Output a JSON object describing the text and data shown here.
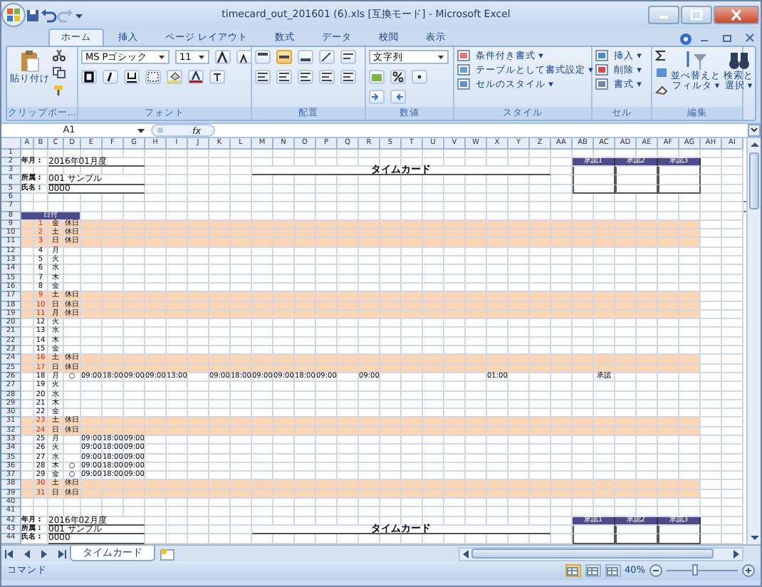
{
  "window": {
    "title": "timecard_out_201601 (6).xls  [互換モード] - Microsoft Excel"
  },
  "tabs": [
    {
      "label": "ホーム",
      "selected": true
    },
    {
      "label": "挿入",
      "selected": false
    },
    {
      "label": "ページ レイアウト",
      "selected": false
    },
    {
      "label": "数式",
      "selected": false
    },
    {
      "label": "データ",
      "selected": false
    },
    {
      "label": "校閲",
      "selected": false
    },
    {
      "label": "表示",
      "selected": false
    }
  ],
  "ribbon": {
    "groups": [
      {
        "kind": "clipboard",
        "label": "クリップボー…",
        "texts": [
          "貼り付け"
        ]
      },
      {
        "kind": "font",
        "label": "フォント",
        "texts": [
          "MS Pゴシック",
          "11"
        ]
      },
      {
        "kind": "alignment",
        "label": "配置"
      },
      {
        "kind": "number",
        "label": "数値",
        "texts": [
          "文字列"
        ]
      },
      {
        "kind": "styles",
        "label": "スタイル",
        "texts": [
          "条件付き書式 ▾",
          "テーブルとして書式設定 ▾",
          "セルのスタイル ▾"
        ]
      },
      {
        "kind": "cells",
        "label": "セル",
        "texts": [
          "挿入 ▾",
          "削除 ▾",
          "書式 ▾"
        ]
      },
      {
        "kind": "editing",
        "label": "編集",
        "texts": [
          "並べ替えと",
          "フィルタ ▾",
          "検索と",
          "選択 ▾"
        ]
      }
    ]
  },
  "formula_bar": {
    "name_box": "A1",
    "fx": "fx"
  },
  "sheet": {
    "columns": [
      "A",
      "B",
      "C",
      "D",
      "E",
      "F",
      "G",
      "H",
      "I",
      "J",
      "K",
      "L",
      "M",
      "N",
      "O",
      "P",
      "Q",
      "R",
      "S",
      "T",
      "U",
      "V",
      "W",
      "X",
      "Y",
      "Z",
      "AA",
      "AB",
      "AC",
      "AD",
      "AE",
      "AF",
      "AG",
      "AH",
      "AI"
    ],
    "row_numbers": [
      "1",
      "2",
      "3",
      "4",
      "5",
      "6",
      "7",
      "8",
      "9",
      "10",
      "11",
      "12",
      "13",
      "14",
      "15",
      "16",
      "17",
      "18",
      "19",
      "20",
      "21",
      "22",
      "23",
      "24",
      "25",
      "26",
      "27",
      "28",
      "29",
      "30",
      "31",
      "32",
      "33",
      "34",
      "35",
      "36",
      "37",
      "38",
      "39",
      "40",
      "41",
      "42",
      "43",
      "44"
    ],
    "cards": [
      {
        "title": "タイムカード",
        "fields": [
          {
            "label": "年月 :",
            "value": "2016年01月度"
          },
          {
            "label": "所属 :",
            "value": "001 サンプル"
          },
          {
            "label": "氏名 :",
            "value": "0000"
          }
        ],
        "approvals": [
          "承認1",
          "承認2",
          "承認3"
        ]
      },
      {
        "title": "タイムカード",
        "fields": [
          {
            "label": "年月 :",
            "value": "2016年02月度"
          },
          {
            "label": "所属 :",
            "value": "001 サンプル"
          },
          {
            "label": "氏名 :",
            "value": "0000"
          }
        ],
        "approvals": [
          "承認1",
          "承認2",
          "承認3"
        ]
      }
    ],
    "band_label": "日付",
    "days": [
      {
        "kind": "holiday",
        "day": "1",
        "weekday": "金",
        "status": "休日"
      },
      {
        "kind": "holiday",
        "day": "2",
        "weekday": "土",
        "status": "休日"
      },
      {
        "kind": "holiday",
        "day": "3",
        "weekday": "日",
        "status": "休日"
      },
      {
        "kind": "workday",
        "day": "4",
        "weekday": "月"
      },
      {
        "kind": "workday",
        "day": "5",
        "weekday": "火"
      },
      {
        "kind": "workday",
        "day": "6",
        "weekday": "水"
      },
      {
        "kind": "workday",
        "day": "7",
        "weekday": "木"
      },
      {
        "kind": "workday",
        "day": "8",
        "weekday": "金"
      },
      {
        "kind": "holiday",
        "day": "9",
        "weekday": "土",
        "status": "休日"
      },
      {
        "kind": "holiday",
        "day": "10",
        "weekday": "日",
        "status": "休日"
      },
      {
        "kind": "holiday",
        "day": "11",
        "weekday": "月",
        "status": "休日"
      },
      {
        "kind": "workday",
        "day": "12",
        "weekday": "火"
      },
      {
        "kind": "workday",
        "day": "13",
        "weekday": "水"
      },
      {
        "kind": "workday",
        "day": "14",
        "weekday": "木"
      },
      {
        "kind": "workday",
        "day": "15",
        "weekday": "金"
      },
      {
        "kind": "holiday",
        "day": "16",
        "weekday": "土",
        "status": "休日"
      },
      {
        "kind": "holiday",
        "day": "17",
        "weekday": "日",
        "status": "休日"
      },
      {
        "kind": "workday",
        "day": "18",
        "weekday": "月",
        "status": "○",
        "times": [
          "09:00",
          "18:00",
          "09:00",
          "09:00",
          "13:00",
          "09:00",
          "18:00",
          "09:00",
          "09:00",
          "18:00",
          "09:00",
          "09:00",
          "01:00",
          "承認"
        ]
      },
      {
        "kind": "workday",
        "day": "19",
        "weekday": "火"
      },
      {
        "kind": "workday",
        "day": "20",
        "weekday": "水"
      },
      {
        "kind": "workday",
        "day": "21",
        "weekday": "木"
      },
      {
        "kind": "workday",
        "day": "22",
        "weekday": "金"
      },
      {
        "kind": "holiday",
        "day": "23",
        "weekday": "土",
        "status": "休日"
      },
      {
        "kind": "holiday",
        "day": "24",
        "weekday": "日",
        "status": "休日"
      },
      {
        "kind": "workday",
        "day": "25",
        "weekday": "月",
        "times": [
          "09:00",
          "18:00",
          "09:00"
        ]
      },
      {
        "kind": "workday",
        "day": "26",
        "weekday": "火",
        "times": [
          "09:00",
          "18:00",
          "09:00"
        ]
      },
      {
        "kind": "workday",
        "day": "27",
        "weekday": "水",
        "times": [
          "09:00",
          "18:00",
          "09:00"
        ]
      },
      {
        "kind": "workday",
        "day": "28",
        "weekday": "木",
        "status": "○",
        "times": [
          "09:00",
          "18:00",
          "09:00"
        ]
      },
      {
        "kind": "workday",
        "day": "29",
        "weekday": "金",
        "status": "○",
        "times": [
          "09:00",
          "18:00",
          "09:00"
        ]
      },
      {
        "kind": "holiday",
        "day": "30",
        "weekday": "土",
        "status": "休日"
      },
      {
        "kind": "holiday",
        "day": "31",
        "weekday": "日",
        "status": "休日"
      }
    ]
  },
  "sheet_tabs": [
    {
      "label": "タイムカード",
      "selected": true
    }
  ],
  "status_bar": {
    "mode": "コマンド",
    "views": [
      {
        "selected": true
      },
      {
        "selected": false
      },
      {
        "selected": false
      }
    ],
    "zoom": "40%",
    "zoom_slider": {
      "level": 0.4
    }
  }
}
